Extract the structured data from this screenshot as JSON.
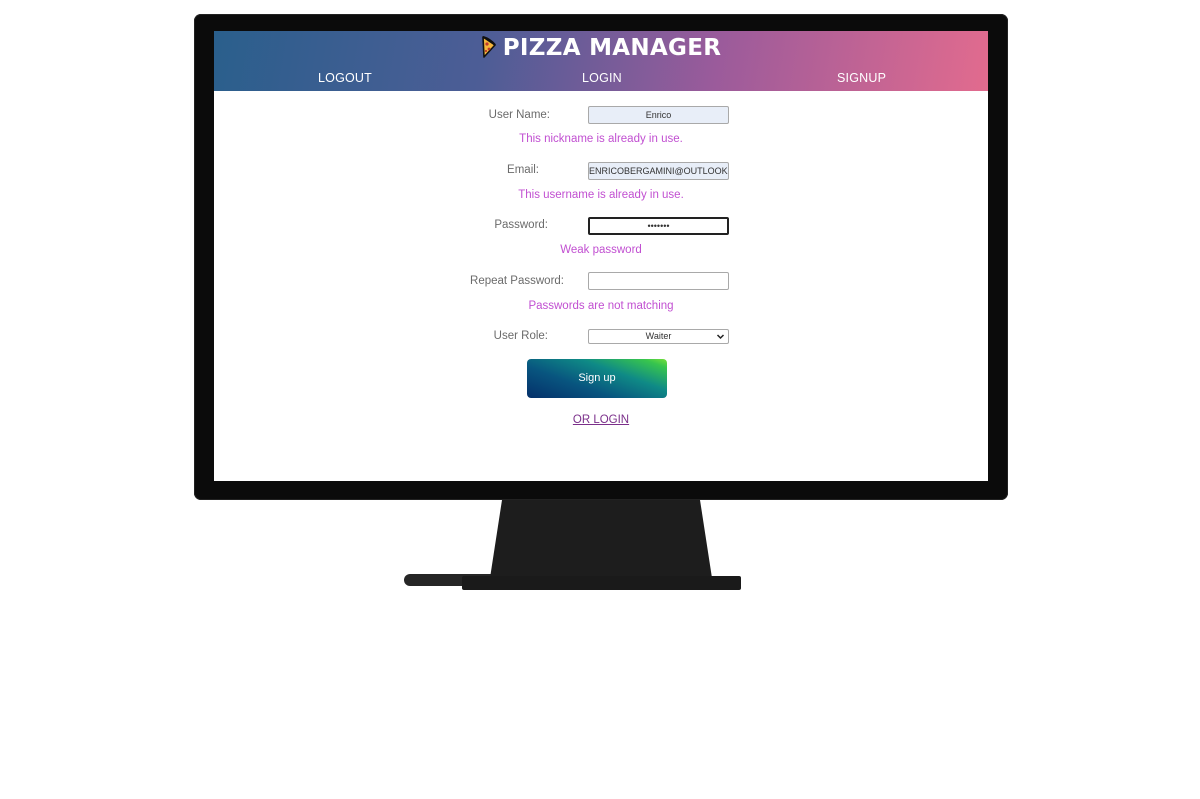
{
  "app": {
    "brand": "PIZZA MANAGER",
    "brand_icon": "pizza-slice-icon"
  },
  "nav": {
    "logout": "LOGOUT",
    "login": "LOGIN",
    "signup": "SIGNUP"
  },
  "form": {
    "username": {
      "label": "User Name:",
      "value": "Enrico",
      "error": "This nickname is already in use."
    },
    "email": {
      "label": "Email:",
      "value": "ENRICOBERGAMINI@OUTLOOK.IT",
      "error": "This username is already in use."
    },
    "password": {
      "label": "Password:",
      "value": "•••••••",
      "error": "Weak password"
    },
    "repeat_password": {
      "label": "Repeat Password:",
      "value": "",
      "error": "Passwords are not matching"
    },
    "role": {
      "label": "User Role:",
      "selected": "Waiter"
    },
    "submit_label": "Sign up",
    "alt_link": "OR LOGIN"
  },
  "colors": {
    "error_text": "#c14fd1",
    "link_text": "#7b2f8a",
    "header_gradient_start": "#2a5f8c",
    "header_gradient_end": "#e26b8e",
    "button_gradient_start": "#05306a",
    "button_gradient_end": "#76e03a"
  }
}
